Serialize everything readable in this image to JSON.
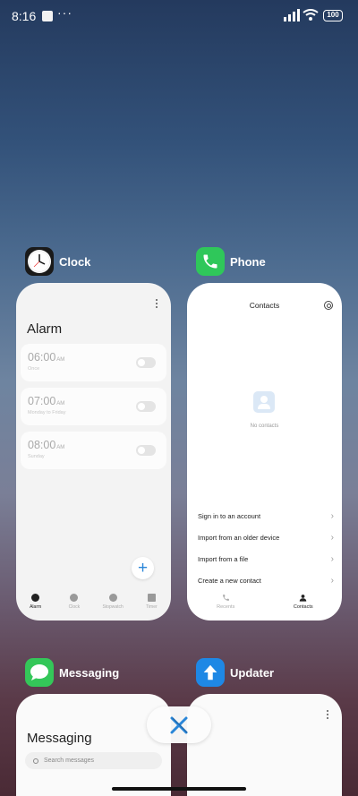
{
  "status_bar": {
    "time": "8:16",
    "more_indicator": "···",
    "battery": "100",
    "icons": [
      "notification-square-icon",
      "signal-icon",
      "wifi-icon",
      "battery-icon"
    ]
  },
  "recents": [
    {
      "app_name": "Clock",
      "icon": "clock-icon",
      "preview": {
        "title": "Alarm",
        "alarms": [
          {
            "time": "06:00",
            "ampm": "AM",
            "subtitle": "Once",
            "enabled": false
          },
          {
            "time": "07:00",
            "ampm": "AM",
            "subtitle": "Monday to Friday",
            "enabled": false
          },
          {
            "time": "08:00",
            "ampm": "AM",
            "subtitle": "Sunday",
            "enabled": false
          }
        ],
        "add_button": "+",
        "nav": [
          "Alarm",
          "Clock",
          "Stopwatch",
          "Timer"
        ],
        "active_nav": "Alarm"
      }
    },
    {
      "app_name": "Phone",
      "icon": "phone-icon",
      "preview": {
        "title": "Contacts",
        "empty_text": "No contacts",
        "menu": [
          "Sign in to an account",
          "Import from an older device",
          "Import from a file",
          "Create a new contact"
        ],
        "nav": [
          "Recents",
          "Contacts"
        ],
        "active_nav": "Contacts"
      }
    },
    {
      "app_name": "Messaging",
      "icon": "messaging-icon",
      "preview": {
        "title": "Messaging",
        "search_placeholder": "Search messages"
      }
    },
    {
      "app_name": "Updater",
      "icon": "updater-icon",
      "preview": {}
    }
  ],
  "clear_all_icon": "clear-all-icon",
  "colors": {
    "accent_blue": "#2a86d8",
    "phone_green": "#2fc75a",
    "messaging_green": "#34c759",
    "updater_blue": "#1e88e5"
  }
}
